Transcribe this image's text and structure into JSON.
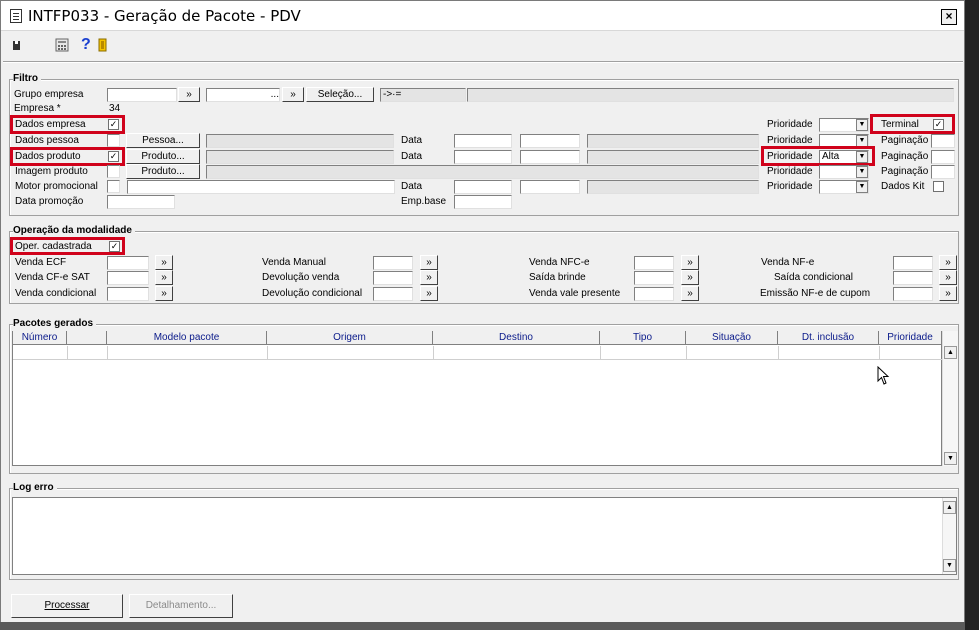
{
  "window": {
    "title": "INTFP033 - Geração de Pacote - PDV",
    "close_label": "×"
  },
  "toolbar": {
    "icons": [
      "save-icon",
      "calculator-icon",
      "help-icon",
      "exit-door-icon"
    ],
    "help_glyph": "?"
  },
  "filtro": {
    "title": "Filtro",
    "grupo_empresa": {
      "label": "Grupo empresa",
      "btn1": "»",
      "btn2": "»",
      "selecao": "Seleção...",
      "op": "->·=",
      "dots": "..."
    },
    "empresa": {
      "label": "Empresa *",
      "value": "34"
    },
    "dados_empresa": {
      "label": "Dados empresa",
      "checked": "✓"
    },
    "dados_pessoa": {
      "label": "Dados pessoa",
      "button": "Pessoa..."
    },
    "dados_produto": {
      "label": "Dados produto",
      "checked": "✓",
      "button": "Produto..."
    },
    "imagem_produto": {
      "label": "Imagem produto",
      "button": "Produto..."
    },
    "motor_promocional": {
      "label": "Motor promocional"
    },
    "data_promocao": {
      "label": "Data promoção"
    },
    "data_label": "Data",
    "emp_base": "Emp.base",
    "prioridade_label": "Prioridade",
    "prioridade_alta": "Alta",
    "terminal": {
      "label": "Terminal",
      "checked": "✓"
    },
    "paginacao": "Paginação",
    "dados_kit": "Dados Kit"
  },
  "operacao": {
    "title": "Operação da modalidade",
    "oper_cadastrada": {
      "label": "Oper. cadastrada",
      "checked": "✓"
    },
    "col1": [
      "Venda ECF",
      "Venda CF-e SAT",
      "Venda condicional"
    ],
    "col2": [
      "Venda Manual",
      "Devolução venda",
      "Devolução condicional"
    ],
    "col3": [
      "Venda NFC-e",
      "Saída brinde",
      "Venda vale presente"
    ],
    "col4": [
      "Venda NF-e",
      "Saída condicional",
      "Emissão NF-e de cupom"
    ],
    "arrow": "»"
  },
  "pacotes": {
    "title": "Pacotes gerados",
    "columns": [
      "Número",
      "Modelo pacote",
      "Origem",
      "Destino",
      "Tipo",
      "Situação",
      "Dt. inclusão",
      "Prioridade"
    ]
  },
  "log": {
    "title": "Log erro"
  },
  "actions": {
    "processar": "Processar",
    "detalhamento": "Detalhamento..."
  }
}
